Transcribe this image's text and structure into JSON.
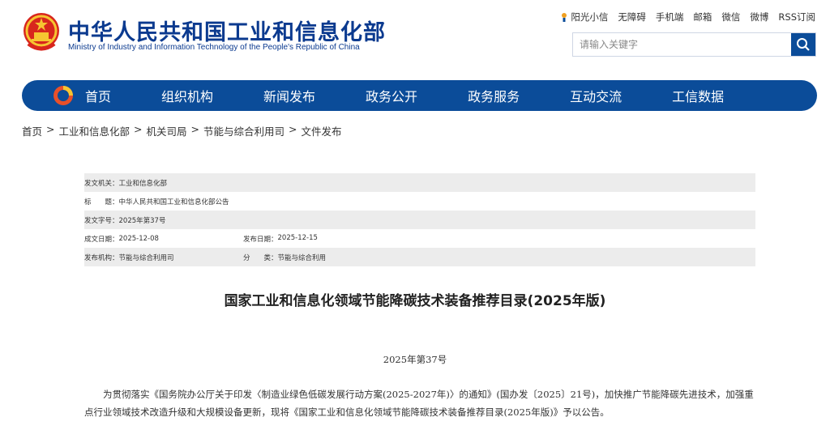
{
  "header": {
    "title_cn": "中华人民共和国工业和信息化部",
    "title_en": "Ministry of Industry and Information Technology of the People's Republic of China",
    "emblem_icon": "national-emblem-icon",
    "toplinks": [
      "阳光小信",
      "无障碍",
      "手机端",
      "邮箱",
      "微信",
      "微博",
      "RSS订阅"
    ],
    "search_placeholder": "请输入关键字"
  },
  "nav": {
    "logo_icon": "miit-logo-icon",
    "items": [
      "首页",
      "组织机构",
      "新闻发布",
      "政务公开",
      "政务服务",
      "互动交流",
      "工信数据"
    ]
  },
  "breadcrumb": [
    "首页",
    "工业和信息化部",
    "机关司局",
    "节能与综合利用司",
    "文件发布"
  ],
  "meta": {
    "issuer_label": "发文机关：",
    "issuer": "工业和信息化部",
    "title_label": "标　　题：",
    "title": "中华人民共和国工业和信息化部公告",
    "docno_label": "发文字号：",
    "docno": "2025年第37号",
    "written_label": "成文日期：",
    "written": "2025-12-08",
    "published_label": "发布日期：",
    "published": "2025-12-15",
    "agency_label": "发布机构：",
    "agency": "节能与综合利用司",
    "category_label": "分　　类：",
    "category": "节能与综合利用"
  },
  "article": {
    "title": "国家工业和信息化领域节能降碳技术装备推荐目录(2025年版)",
    "doc_number": "2025年第37号",
    "paragraph": "为贯彻落实《国务院办公厅关于印发〈制造业绿色低碳发展行动方案(2025-2027年)〉的通知》(国办发〔2025〕21号)，加快推广节能降碳先进技术，加强重点行业领域技术改造升级和大规模设备更新，现将《国家工业和信息化领域节能降碳技术装备推荐目录(2025年版)》予以公告。"
  },
  "colors": {
    "brand_blue": "#0b4c99",
    "title_blue": "#0b3a8f",
    "row_shade": "#ececec"
  }
}
